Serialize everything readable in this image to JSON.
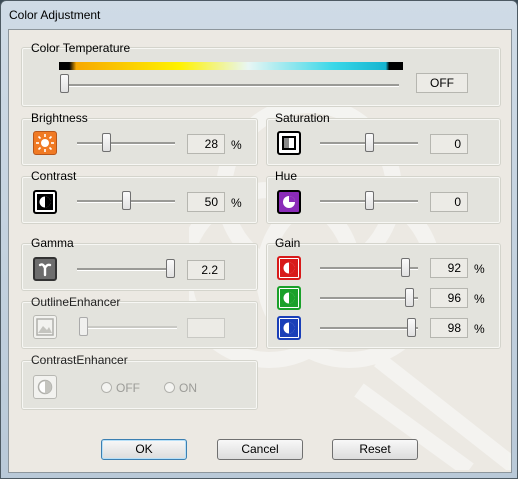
{
  "window": {
    "title": "Color Adjustment"
  },
  "color_temperature": {
    "label": "Color Temperature",
    "value": "OFF"
  },
  "brightness": {
    "label": "Brightness",
    "value": "28",
    "unit": "%",
    "icon": "brightness-sun-icon",
    "level": 0.28
  },
  "saturation": {
    "label": "Saturation",
    "value": "0",
    "icon": "saturation-icon",
    "level": 0.5
  },
  "contrast": {
    "label": "Contrast",
    "value": "50",
    "unit": "%",
    "icon": "contrast-icon",
    "level": 0.5
  },
  "hue": {
    "label": "Hue",
    "value": "0",
    "icon": "hue-icon",
    "level": 0.5
  },
  "gamma": {
    "label": "Gamma",
    "value": "2.2",
    "icon": "gamma-icon"
  },
  "gain": {
    "label": "Gain",
    "red": {
      "value": "92",
      "unit": "%",
      "icon": "red-channel-icon",
      "color": "#d81a1a"
    },
    "green": {
      "value": "96",
      "unit": "%",
      "icon": "green-channel-icon",
      "color": "#1aa12a"
    },
    "blue": {
      "value": "98",
      "unit": "%",
      "icon": "blue-channel-icon",
      "color": "#1a3fb8"
    }
  },
  "outline_enhancer": {
    "label": "OutlineEnhancer",
    "value": "",
    "icon": "outline-enhancer-icon"
  },
  "contrast_enhancer": {
    "label": "ContrastEnhancer",
    "icon": "contrast-enhancer-icon",
    "options": [
      "OFF",
      "ON"
    ]
  },
  "buttons": {
    "ok": "OK",
    "cancel": "Cancel",
    "reset": "Reset"
  },
  "colors": {
    "brightness_icon": "#f07a24",
    "hue_icon": "#8a2bb8",
    "window_bg": "#ece9e3"
  }
}
